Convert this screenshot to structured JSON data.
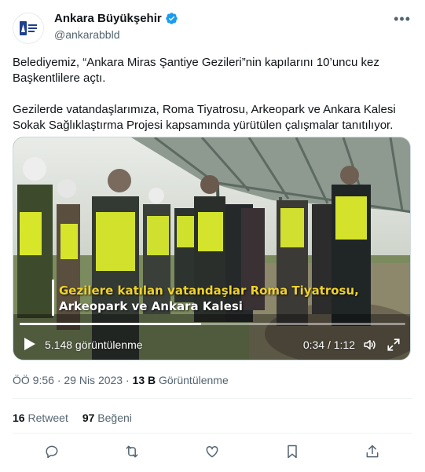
{
  "account": {
    "display_name": "Ankara Büyükşehir",
    "handle": "@ankarabbld"
  },
  "tweet": {
    "paragraph1": "Belediyemiz, “Ankara Miras Şantiye Gezileri”nin kapılarını 10’uncu kez Başkentlilere açtı.",
    "paragraph2": "Gezilerde vatandaşlarımıza, Roma Tiyatrosu, Arkeopark ve Ankara Kalesi Sokak Sağlıklaştırma Projesi kapsamında yürütülen çalışmalar tanıtılıyor."
  },
  "video": {
    "caption_line1": "Gezilere katılan vatandaşlar Roma Tiyatrosu,",
    "caption_line2": "Arkeopark ve Ankara Kalesi",
    "views_label": "5.148 görüntülenme",
    "time_label": "0:34 / 1:12",
    "progress": 0.47
  },
  "meta": {
    "time": "ÖÖ 9:56",
    "sep": "·",
    "date": "29 Nis 2023",
    "view_count": "13 B",
    "view_label": "Görüntülenme"
  },
  "stats": {
    "retweets": "16",
    "retweets_label": "Retweet",
    "likes": "97",
    "likes_label": "Beğeni"
  },
  "colors": {
    "verified": "#1d9bf0",
    "caption_yellow": "#f0d22c",
    "secondary_text": "#536471"
  },
  "icons": [
    "more-icon",
    "verified-icon",
    "play-icon",
    "volume-icon",
    "fullscreen-icon",
    "reply-icon",
    "retweet-icon",
    "like-icon",
    "bookmark-icon",
    "share-icon"
  ]
}
